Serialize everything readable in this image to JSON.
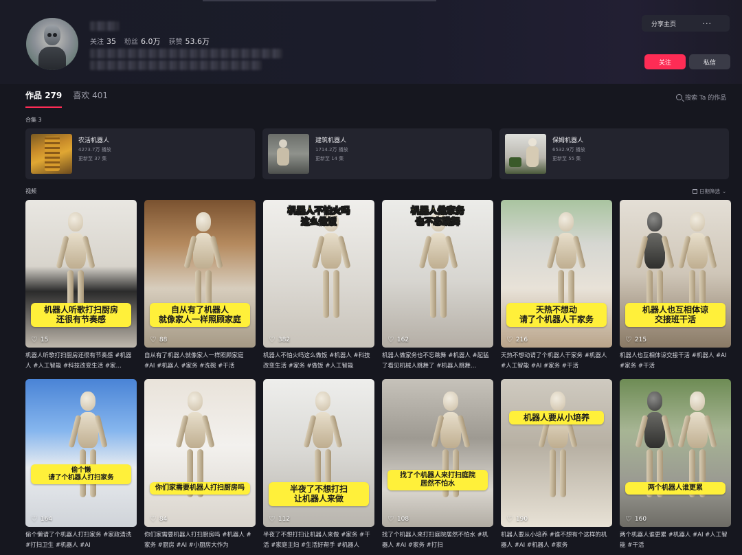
{
  "profile": {
    "stats": [
      {
        "label": "关注",
        "value": "35"
      },
      {
        "label": "粉丝",
        "value": "6.0万"
      },
      {
        "label": "获赞",
        "value": "53.6万"
      }
    ]
  },
  "actions": {
    "share_label": "分享主页",
    "more_label": "···",
    "follow_label": "关注",
    "message_label": "私信"
  },
  "tabs": [
    {
      "label": "作品",
      "count": "279"
    },
    {
      "label": "喜欢",
      "count": "401"
    }
  ],
  "search_label": "搜索 Ta 的作品",
  "collections_label": "合集 3",
  "collections": [
    {
      "title": "农活机器人",
      "plays": "4273.7万 播放",
      "update": "更新至 37 集"
    },
    {
      "title": "建筑机器人",
      "plays": "1714.2万 播放",
      "update": "更新至 14 集"
    },
    {
      "title": "保姆机器人",
      "plays": "6532.9万 播放",
      "update": "更新至 55 集"
    }
  ],
  "videos_label": "视频",
  "date_filter_label": "日期筛选",
  "videos": [
    {
      "caption": "机器人听歌打扫厨房\n还很有节奏感",
      "caption_pos": "bottom",
      "likes": "15",
      "desc": "机器人听歌打扫厨房还很有节奏感 #机器人 #人工智能 #科技改变生活 #家…"
    },
    {
      "caption": "自从有了机器人\n就像家人一样照顾家庭",
      "caption_pos": "bottom",
      "likes": "88",
      "desc": "自从有了机器人就像家人一样照顾家庭 #AI #机器人 #家务 #洗碗 #干活"
    },
    {
      "caption": "机器人不怕火吗\n这么做饭",
      "caption_pos": "top",
      "likes": "382",
      "desc": "机器人不怕火吗这么做饭 #机器人 #科技改变生活 #家务 #做饭 #人工智能"
    },
    {
      "caption": "机器人做家务\n也不忘跳舞",
      "caption_pos": "top",
      "likes": "162",
      "desc": "机器人做家务也不忘跳舞 #机器人 #起猛了看见机械人跳舞了 #机器人跳舞…"
    },
    {
      "caption": "天热不想动\n请了个机器人干家务",
      "caption_pos": "bottom",
      "likes": "216",
      "desc": "天热不想动请了个机器人干家务 #机器人 #人工智能 #AI #家务 #干活"
    },
    {
      "caption": "机器人也互相体谅\n交接班干活",
      "caption_pos": "bottom",
      "likes": "215",
      "desc": "机器人也互相体谅交接干活 #机器人 #AI #家务 #干活"
    },
    {
      "caption": "偷个懒\n请了个机器人打扫家务",
      "caption_pos": "lower",
      "likes": "164",
      "desc": "偷个懒请了个机器人打扫家务 #家政清洗 #打扫卫生 #机器人 #AI"
    },
    {
      "caption": "你们家需要机器人打扫厨房吗",
      "caption_pos": "bottom",
      "likes": "84",
      "desc": "你们家需要机器人打扫厨房吗 #机器人 #家务 #厨房 #AI #小厨房大作为"
    },
    {
      "caption": "半夜了不想打扫\n让机器人来做",
      "caption_pos": "bottom",
      "likes": "112",
      "desc": "半夜了不想打扫让机器人来做 #家务 #干活 #家庭主妇 #生活好帮手 #机器人"
    },
    {
      "caption": "找了个机器人来打扫庭院\n居然不怕水",
      "caption_pos": "middle",
      "likes": "108",
      "desc": "找了个机器人来打扫庭院居然不怕水 #机器人 #AI #家务 #打扫"
    },
    {
      "caption": "机器人要从小培养",
      "caption_pos": "top2",
      "likes": "190",
      "desc": "机器人要从小培养 #谁不想有个这样的机器人 #AI #机器人 #家务"
    },
    {
      "caption": "两个机器人谁更累",
      "caption_pos": "bottom",
      "likes": "160",
      "desc": "两个机器人谁更累 #机器人 #AI #人工智能 #干活"
    }
  ],
  "colors": {
    "accent": "#fe2c55",
    "caption_bg": "#fff03a",
    "page_bg": "#16171f"
  }
}
